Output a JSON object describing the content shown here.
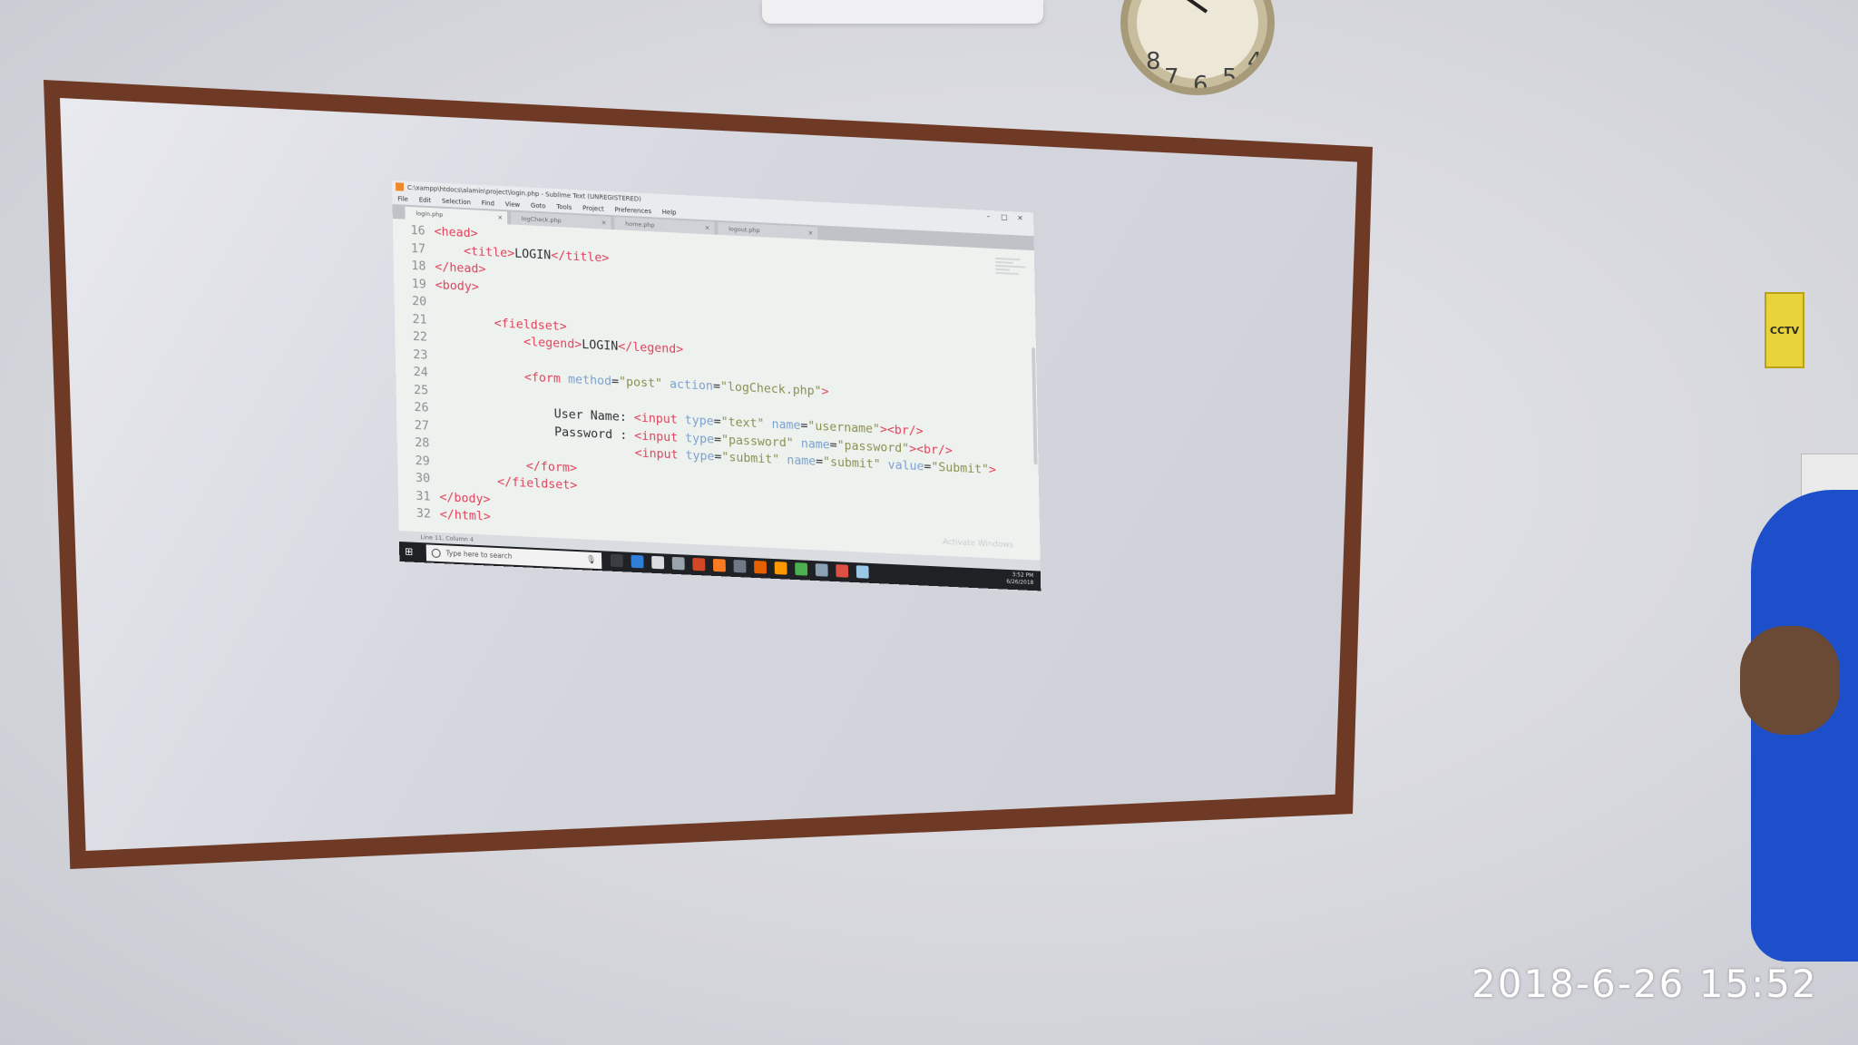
{
  "window": {
    "title": "C:\\xampp\\htdocs\\alamin\\project\\login.php - Sublime Text (UNREGISTERED)",
    "controls": [
      "–",
      "□",
      "×"
    ]
  },
  "menu": [
    "File",
    "Edit",
    "Selection",
    "Find",
    "View",
    "Goto",
    "Tools",
    "Project",
    "Preferences",
    "Help"
  ],
  "tabs": [
    {
      "label": "login.php",
      "active": true
    },
    {
      "label": "logCheck.php",
      "active": false
    },
    {
      "label": "home.php",
      "active": false
    },
    {
      "label": "logout.php",
      "active": false
    }
  ],
  "code_lines": [
    {
      "n": "16",
      "html": "<span class=\"tg\">&lt;head&gt;</span>"
    },
    {
      "n": "17",
      "html": "    <span class=\"tg\">&lt;title&gt;</span>LOGIN<span class=\"tg\">&lt;/title&gt;</span>"
    },
    {
      "n": "18",
      "html": "<span class=\"tg\">&lt;/head&gt;</span>"
    },
    {
      "n": "19",
      "html": "<span class=\"tg\">&lt;body&gt;</span>"
    },
    {
      "n": "20",
      "html": ""
    },
    {
      "n": "21",
      "html": "        <span class=\"tg\">&lt;fieldset&gt;</span>"
    },
    {
      "n": "22",
      "html": "            <span class=\"tg\">&lt;legend&gt;</span>LOGIN<span class=\"tg\">&lt;/legend&gt;</span>"
    },
    {
      "n": "23",
      "html": ""
    },
    {
      "n": "24",
      "html": "            <span class=\"tg\">&lt;form</span> <span class=\"at\">method</span>=<span class=\"st\">\"post\"</span> <span class=\"at\">action</span>=<span class=\"st\">\"logCheck.php\"</span><span class=\"tg\">&gt;</span>"
    },
    {
      "n": "25",
      "html": ""
    },
    {
      "n": "26",
      "html": "                User Name: <span class=\"tg\">&lt;input</span> <span class=\"at\">type</span>=<span class=\"st\">\"text\"</span> <span class=\"at\">name</span>=<span class=\"st\">\"username\"</span><span class=\"tg\">&gt;&lt;br/&gt;</span>"
    },
    {
      "n": "27",
      "html": "                Password : <span class=\"tg\">&lt;input</span> <span class=\"at\">type</span>=<span class=\"st\">\"password\"</span> <span class=\"at\">name</span>=<span class=\"st\">\"password\"</span><span class=\"tg\">&gt;&lt;br/&gt;</span>"
    },
    {
      "n": "28",
      "html": "                           <span class=\"tg\">&lt;input</span> <span class=\"at\">type</span>=<span class=\"st\">\"submit\"</span> <span class=\"at\">name</span>=<span class=\"st\">\"submit\"</span> <span class=\"at\">value</span>=<span class=\"st\">\"Submit\"</span><span class=\"tg\">&gt;</span>"
    },
    {
      "n": "29",
      "html": "            <span class=\"tg\">&lt;/form&gt;</span>"
    },
    {
      "n": "30",
      "html": "        <span class=\"tg\">&lt;/fieldset&gt;</span>"
    },
    {
      "n": "31",
      "html": "<span class=\"tg\">&lt;/body&gt;</span>"
    },
    {
      "n": "32",
      "html": "<span class=\"tg\">&lt;/html&gt;</span>"
    }
  ],
  "editor": {
    "watermark": "Activate Windows"
  },
  "statusbar": {
    "position": "Line 11, Column 4"
  },
  "taskbar": {
    "search_placeholder": "Type here to search",
    "icons": [
      {
        "name": "task-view-icon",
        "color": "#3a3d42"
      },
      {
        "name": "edge-icon",
        "color": "#2f7fd8"
      },
      {
        "name": "explorer-icon",
        "color": "#d9dde2"
      },
      {
        "name": "store-icon",
        "color": "#9aa4ad"
      },
      {
        "name": "office-icon",
        "color": "#d24726"
      },
      {
        "name": "xampp-icon",
        "color": "#fb7a24"
      },
      {
        "name": "tiles-icon",
        "color": "#6e7a87"
      },
      {
        "name": "firefox-icon",
        "color": "#e66000"
      },
      {
        "name": "sublime-icon",
        "color": "#ff9800"
      },
      {
        "name": "photos-icon",
        "color": "#4caf50"
      },
      {
        "name": "mountain-icon",
        "color": "#8aa1b5"
      },
      {
        "name": "chrome-icon",
        "color": "#dd5144"
      },
      {
        "name": "notepad-icon",
        "color": "#9cc8e8"
      }
    ],
    "tray_time": "3:52 PM",
    "tray_date": "6/26/2018"
  },
  "room": {
    "cctv_label": "CCTV",
    "timestamp": "2018-6-26 15:52"
  }
}
